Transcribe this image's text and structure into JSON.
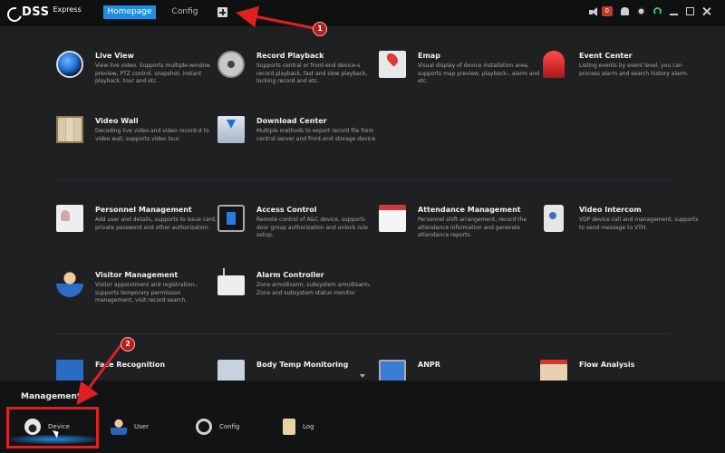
{
  "app": {
    "logo_main": "DSS",
    "logo_sub": "Express"
  },
  "tabs": [
    {
      "label": "Homepage",
      "active": true
    },
    {
      "label": "Config",
      "active": false
    }
  ],
  "topbar": {
    "alarm_count": "0"
  },
  "modules": [
    {
      "title": "Live View",
      "desc": "View live video. Supports multiple-window preview, PTZ control, snapshot, instant playback, tour and etc.",
      "icon": "live-view-icon"
    },
    {
      "title": "Record Playback",
      "desc": "Supports central or front-end device-s record playback, fast and slow playback, locking record and etc.",
      "icon": "film-reel-icon"
    },
    {
      "title": "Emap",
      "desc": "Visual display of device installation area, supports map preview, playback-, alarm and etc.",
      "icon": "map-pin-icon"
    },
    {
      "title": "Event Center",
      "desc": "Listing events by event level, you can process alarm and search history alarm.",
      "icon": "siren-icon"
    },
    {
      "title": "Video Wall",
      "desc": "Decoding live video and video record-d to video wall, supports video tour.",
      "icon": "video-wall-icon"
    },
    {
      "title": "Download Center",
      "desc": "Multiple methods to export record file from central server and front-end storage device.",
      "icon": "download-icon"
    },
    {
      "title": "Personnel Management",
      "desc": "Add user and details, supports to issue card, private password and other authorization.",
      "icon": "id-badge-icon"
    },
    {
      "title": "Access Control",
      "desc": "Remote control of A&C device, supports door group authorization and unlock rule setup.",
      "icon": "access-control-icon"
    },
    {
      "title": "Attendance Management",
      "desc": "Personnel shift arrangement, record the attendance information and generate attendance reports.",
      "icon": "calendar-icon"
    },
    {
      "title": "Video Intercom",
      "desc": "VDP device call and management, supports to send message to VTH.",
      "icon": "intercom-icon"
    },
    {
      "title": "Visitor Management",
      "desc": "Visitor appointment and registration-, supports temporary permission management, visit record search.",
      "icon": "visitor-icon"
    },
    {
      "title": "Alarm Controller",
      "desc": "Zone arm/disarm, subsystem arm/disarm, Zone and subsystem status monitor.",
      "icon": "alarm-controller-icon"
    },
    {
      "title": "Face Recognition",
      "desc": "",
      "icon": "face-recognition-icon"
    },
    {
      "title": "Body Temp Monitoring",
      "desc": "",
      "icon": "body-temp-icon"
    },
    {
      "title": "ANPR",
      "desc": "",
      "icon": "anpr-icon"
    },
    {
      "title": "Flow Analysis",
      "desc": "",
      "icon": "flow-analysis-icon"
    }
  ],
  "management": {
    "title": "Management",
    "items": [
      {
        "label": "Device",
        "icon": "device-icon"
      },
      {
        "label": "User",
        "icon": "user-icon"
      },
      {
        "label": "Config",
        "icon": "gear-icon"
      },
      {
        "label": "Log",
        "icon": "log-icon"
      }
    ]
  },
  "annotations": {
    "step1": "1",
    "step2": "2",
    "color": "#e02020"
  }
}
